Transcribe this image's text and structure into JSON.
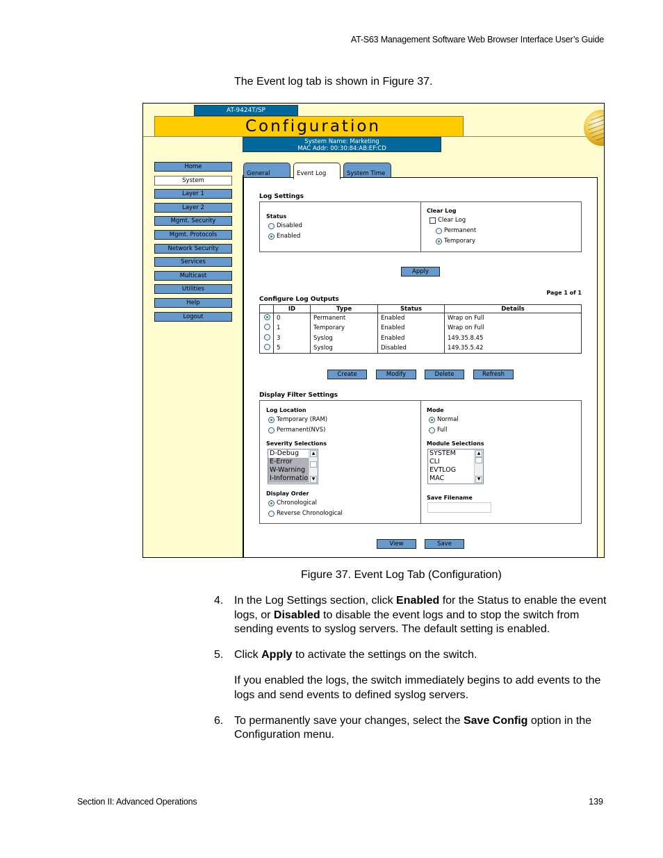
{
  "header": {
    "running_title": "AT-S63 Management Software Web Browser Interface User’s Guide"
  },
  "intro": "The Event log tab is shown in Figure 37.",
  "figure": {
    "model": "AT-9424T/SP",
    "banner_title": "Configuration",
    "system_name": "System Name: Marketing",
    "mac_addr": "MAC Addr: 00:30:84:AB:EF:CD",
    "icons": {
      "globe": "globe-icon"
    },
    "colors": {
      "banner": "#ffcc00",
      "info_bar": "#00689a",
      "nav_button": "#6699cc",
      "page_bg": "#fffdd0"
    },
    "sidebar": {
      "items": [
        {
          "label": "Home",
          "active": false
        },
        {
          "label": "System",
          "active": true
        },
        {
          "label": "Layer 1",
          "active": false
        },
        {
          "label": "Layer 2",
          "active": false
        },
        {
          "label": "Mgmt. Security",
          "active": false
        },
        {
          "label": "Mgmt. Protocols",
          "active": false
        },
        {
          "label": "Network Security",
          "active": false
        },
        {
          "label": "Services",
          "active": false
        },
        {
          "label": "Multicast",
          "active": false
        },
        {
          "label": "Utilities",
          "active": false
        },
        {
          "label": "Help",
          "active": false
        },
        {
          "label": "Logout",
          "active": false
        }
      ]
    },
    "tabs": [
      {
        "label": "General",
        "active": false
      },
      {
        "label": "Event Log",
        "active": true
      },
      {
        "label": "System Time",
        "active": false
      }
    ],
    "log_settings": {
      "title": "Log Settings",
      "status": {
        "label": "Status",
        "options": [
          "Disabled",
          "Enabled"
        ],
        "selected": "Enabled"
      },
      "clear_log": {
        "label": "Clear Log",
        "checkbox_label": "Clear Log",
        "checked": false,
        "options": [
          "Permanent",
          "Temporary"
        ],
        "selected": "Temporary"
      },
      "apply_label": "Apply"
    },
    "outputs": {
      "page_info": "Page 1 of 1",
      "title": "Configure Log Outputs",
      "columns": [
        "",
        "ID",
        "Type",
        "Status",
        "Details"
      ],
      "rows": [
        {
          "selected": true,
          "id": "0",
          "type": "Permanent",
          "status": "Enabled",
          "details": "Wrap on Full"
        },
        {
          "selected": false,
          "id": "1",
          "type": "Temporary",
          "status": "Enabled",
          "details": "Wrap on Full"
        },
        {
          "selected": false,
          "id": "3",
          "type": "Syslog",
          "status": "Enabled",
          "details": "149.35.8.45"
        },
        {
          "selected": false,
          "id": "5",
          "type": "Syslog",
          "status": "Disabled",
          "details": "149.35.5.42"
        }
      ],
      "buttons": {
        "create": "Create",
        "modify": "Modify",
        "delete": "Delete",
        "refresh": "Refresh"
      }
    },
    "filter": {
      "title": "Display Filter Settings",
      "log_location": {
        "label": "Log Location",
        "options": [
          "Temporary (RAM)",
          "Permanent(NVS)"
        ],
        "selected": "Temporary (RAM)"
      },
      "mode": {
        "label": "Mode",
        "options": [
          "Normal",
          "Full"
        ],
        "selected": "Normal"
      },
      "severity": {
        "label": "Severity Selections",
        "items": [
          "D-Debug",
          "E-Error",
          "W-Warning",
          "I-Information"
        ],
        "selected": [
          "E-Error",
          "W-Warning",
          "I-Information"
        ]
      },
      "modules": {
        "label": "Module Selections",
        "items": [
          "SYSTEM",
          "CLI",
          "EVTLOG",
          "MAC"
        ],
        "selected": []
      },
      "display_order": {
        "label": "Display Order",
        "options": [
          "Chronological",
          "Reverse Chronological"
        ],
        "selected": "Chronological"
      },
      "save_filename": {
        "label": "Save Filename",
        "value": ""
      },
      "buttons": {
        "view": "View",
        "save": "Save"
      }
    }
  },
  "caption": "Figure 37. Event Log Tab (Configuration)",
  "steps": [
    {
      "num": "4.",
      "parts": [
        {
          "t": "In the Log Settings section, click "
        },
        {
          "t": "Enabled",
          "b": true
        },
        {
          "t": " for the Status to enable the event logs, or "
        },
        {
          "t": "Disabled",
          "b": true
        },
        {
          "t": " to disable the event logs and to stop the switch from sending events to syslog servers. The default setting is enabled."
        }
      ]
    },
    {
      "num": "5.",
      "parts": [
        {
          "t": "Click "
        },
        {
          "t": "Apply",
          "b": true
        },
        {
          "t": " to activate the settings on the switch."
        }
      ],
      "extra": "If you enabled the logs, the switch immediately begins to add events to the logs and send events to defined syslog servers."
    },
    {
      "num": "6.",
      "parts": [
        {
          "t": "To permanently save your changes, select the "
        },
        {
          "t": "Save Config",
          "b": true
        },
        {
          "t": " option in the Configuration menu."
        }
      ]
    }
  ],
  "footer": {
    "section": "Section II: Advanced Operations",
    "page": "139"
  }
}
